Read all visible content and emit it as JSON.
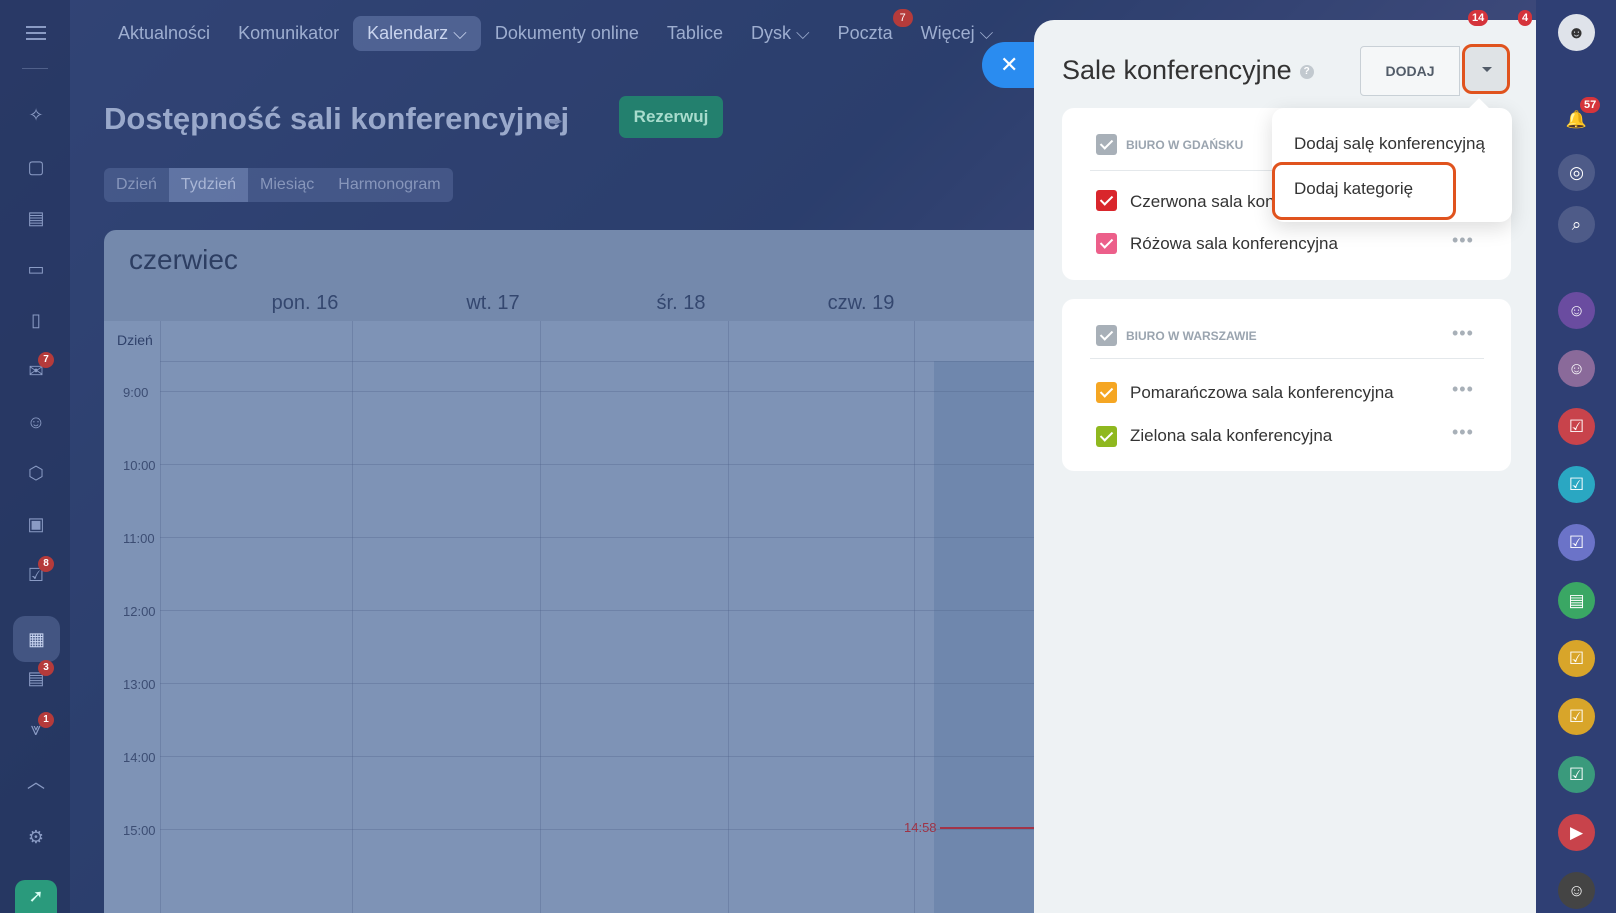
{
  "nav": {
    "items": [
      {
        "label": "Aktualności"
      },
      {
        "label": "Komunikator"
      },
      {
        "label": "Kalendarz ⌵"
      },
      {
        "label": "Dokumenty online"
      },
      {
        "label": "Tablice"
      },
      {
        "label": "Dysk ⌵"
      },
      {
        "label": "Poczta",
        "badge": "7"
      },
      {
        "label": "Więcej ⌵"
      }
    ],
    "active": "Kalendarz"
  },
  "left_sidebar": {
    "badges": {
      "mail": "7",
      "tasks": "8",
      "crm": "3",
      "pipeline": "1"
    },
    "icons": [
      "hamburger-icon",
      "sparkle-icon",
      "chat-icon",
      "feed-icon",
      "inbox-icon",
      "document-icon",
      "mail-icon",
      "users-icon",
      "hexagon-icon",
      "presentation-icon",
      "tasks-icon",
      "calendar-icon",
      "crm-icon",
      "funnel-icon",
      "collapse-icon",
      "gear-icon",
      "rocket-icon"
    ]
  },
  "page": {
    "title": "Dostępność sali konferencyjnej",
    "reserve_label": "Rezerwuj",
    "view_tabs": [
      "Dzień",
      "Tydzień",
      "Miesiąc",
      "Harmonogram"
    ],
    "active_view": "Tydzień"
  },
  "calendar": {
    "month": "czerwiec",
    "days": [
      "pon. 16",
      "wt. 17",
      "śr. 18",
      "czw. 19"
    ],
    "allday_label": "Dzień",
    "hours": [
      "9:00",
      "10:00",
      "11:00",
      "12:00",
      "13:00",
      "14:00",
      "15:00"
    ],
    "now_label": "14:58"
  },
  "panel": {
    "title": "Sale konferencyjne",
    "help_glyph": "?",
    "add_label": "DODAJ",
    "groups": [
      {
        "name": "BIURO W GDAŃSKU",
        "rooms": [
          {
            "label": "Czerwona sala kon",
            "color": "#d9262c"
          },
          {
            "label": "Różowa sala konferencyjna",
            "color": "#ec5f8a"
          }
        ]
      },
      {
        "name": "BIURO W WARSZAWIE",
        "rooms": [
          {
            "label": "Pomarańczowa sala konferencyjna",
            "color": "#f5a623"
          },
          {
            "label": "Zielona sala konferencyjna",
            "color": "#8fb81f"
          }
        ]
      }
    ],
    "group_checkbox_color": "#a8b0b8",
    "more_glyph": "•••"
  },
  "dropdown": {
    "items": [
      "Dodaj salę konferencyjną",
      "Dodaj kategorię"
    ],
    "highlighted": "Dodaj kategorię"
  },
  "right_sidebar": {
    "badges": {
      "top_left": "4",
      "top_right": "14",
      "notifications": "57"
    }
  },
  "colors": {
    "accent_blue": "#2a8cf0",
    "highlight": "#e0531e",
    "reserve_green": "#23806e",
    "now_line": "#a23449"
  }
}
